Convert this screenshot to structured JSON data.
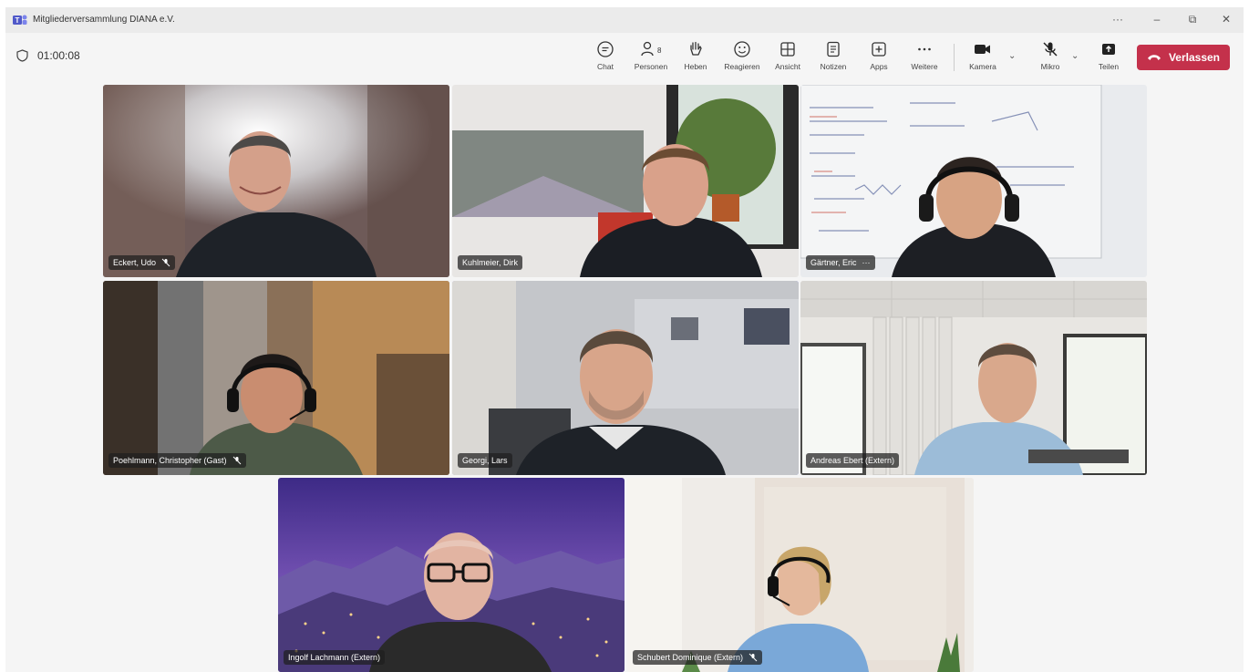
{
  "window": {
    "title": "Mitgliederversammlung DIANA e.V.",
    "controls": {
      "more": "···",
      "minimize": "–",
      "restore": "⧉",
      "close": "✕"
    }
  },
  "toolbar": {
    "timer": "01:00:08",
    "buttons": [
      {
        "label": "Chat",
        "icon": "chat-icon"
      },
      {
        "label": "Personen",
        "icon": "people-icon",
        "count": "8"
      },
      {
        "label": "Heben",
        "icon": "raise-hand-icon"
      },
      {
        "label": "Reagieren",
        "icon": "smiley-icon"
      },
      {
        "label": "Ansicht",
        "icon": "view-grid-icon"
      },
      {
        "label": "Notizen",
        "icon": "notes-icon"
      },
      {
        "label": "Apps",
        "icon": "apps-plus-icon"
      },
      {
        "label": "Weitere",
        "icon": "more-icon"
      },
      {
        "label": "Kamera",
        "icon": "camera-icon"
      },
      {
        "label": "Mikro",
        "icon": "mic-muted-icon"
      },
      {
        "label": "Teilen",
        "icon": "share-icon"
      }
    ],
    "leave_label": "Verlassen",
    "leave_color": "#c4314b"
  },
  "participants": [
    {
      "name": "Eckert, Udo",
      "muted": true
    },
    {
      "name": "Kuhlmeier, Dirk",
      "muted": false
    },
    {
      "name": "Gärtner, Eric",
      "muted": false,
      "more": "···"
    },
    {
      "name": "Poehlmann, Christopher (Gast)",
      "muted": true
    },
    {
      "name": "Georgi, Lars",
      "muted": false,
      "active_speaker": true
    },
    {
      "name": "Andreas Ebert (Extern)",
      "muted": false
    },
    {
      "name": "Ingolf Lachmann (Extern)",
      "muted": false
    },
    {
      "name": "Schubert Dominique (Extern)",
      "muted": true
    }
  ],
  "colors": {
    "accent": "#7b83eb",
    "leave": "#c4314b"
  }
}
